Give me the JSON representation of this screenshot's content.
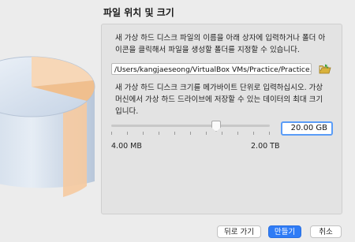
{
  "dialog": {
    "title": "파일 위치 및 크기"
  },
  "location": {
    "description_line1": "새 가상 하드 디스크 파일의 이름을 아래 상자에 입력하거나 폴더 아",
    "description_line2": "이콘을 클릭해서 파일을 생성할 폴더를 지정할 수 있습니다.",
    "path_value": "/Users/kangjaeseong/VirtualBox VMs/Practice/Practice.vdi",
    "folder_icon": "folder-browse-icon"
  },
  "size": {
    "description_line1": "새 가상 하드 디스크 크기를 메가바이트 단위로 입력하십시오. 가상",
    "description_line2": "머신에서 가상 하드 드라이브에 저장할 수 있는 데이터의 최대 크기",
    "description_line3": "입니다.",
    "value_text": "20.00 GB",
    "slider_position": 0.66,
    "range_min_label": "4.00 MB",
    "range_max_label": "2.00 TB"
  },
  "buttons": {
    "back_label": "뒤로 가기",
    "create_label": "만들기",
    "cancel_label": "취소"
  },
  "colors": {
    "primary_button": "#2f7cf6",
    "focus_ring": "#5a9cf7"
  }
}
